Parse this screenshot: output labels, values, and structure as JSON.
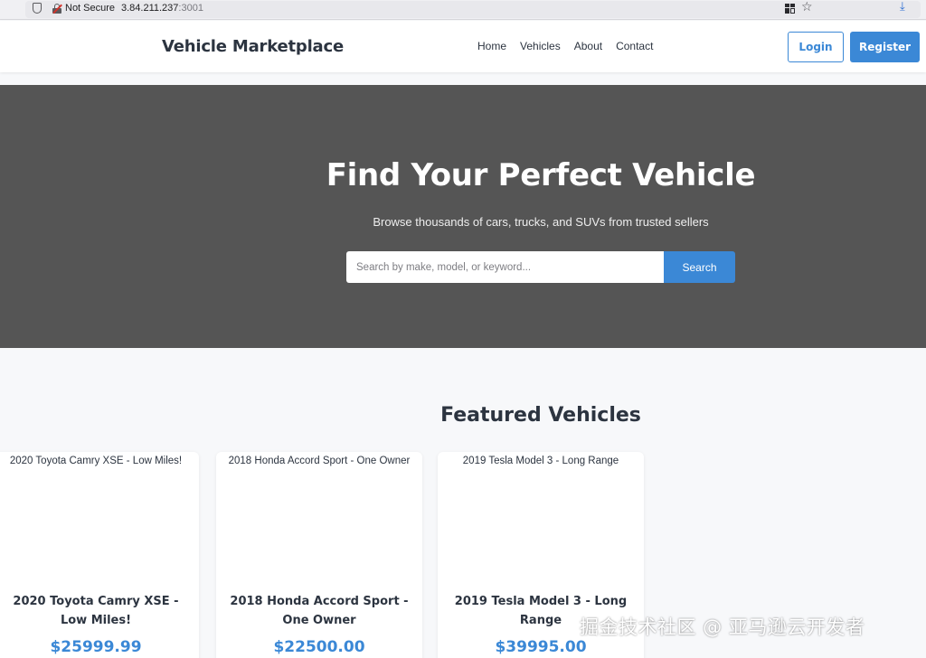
{
  "browser": {
    "security_label": "Not Secure",
    "url_host": "3.84.211.237",
    "url_port": ":3001"
  },
  "header": {
    "brand": "Vehicle Marketplace",
    "nav": [
      "Home",
      "Vehicles",
      "About",
      "Contact"
    ],
    "login_label": "Login",
    "register_label": "Register"
  },
  "hero": {
    "title": "Find Your Perfect Vehicle",
    "subtitle": "Browse thousands of cars, trucks, and SUVs from trusted sellers",
    "search_placeholder": "Search by make, model, or keyword...",
    "search_button": "Search"
  },
  "featured": {
    "title": "Featured Vehicles",
    "cards": [
      {
        "image_alt": "2020 Toyota Camry XSE - Low Miles!",
        "title": "2020 Toyota Camry XSE - Low Miles!",
        "price": "$25999.99"
      },
      {
        "image_alt": "2018 Honda Accord Sport - One Owner",
        "title": "2018 Honda Accord Sport - One Owner",
        "price": "$22500.00"
      },
      {
        "image_alt": "2019 Tesla Model 3 - Long Range",
        "title": "2019 Tesla Model 3 - Long Range",
        "price": "$39995.00"
      }
    ]
  },
  "colors": {
    "accent": "#3b88d6",
    "hero_bg": "#555555",
    "text": "#2c3440"
  },
  "watermark": "掘金技术社区 @ 亚马逊云开发者"
}
